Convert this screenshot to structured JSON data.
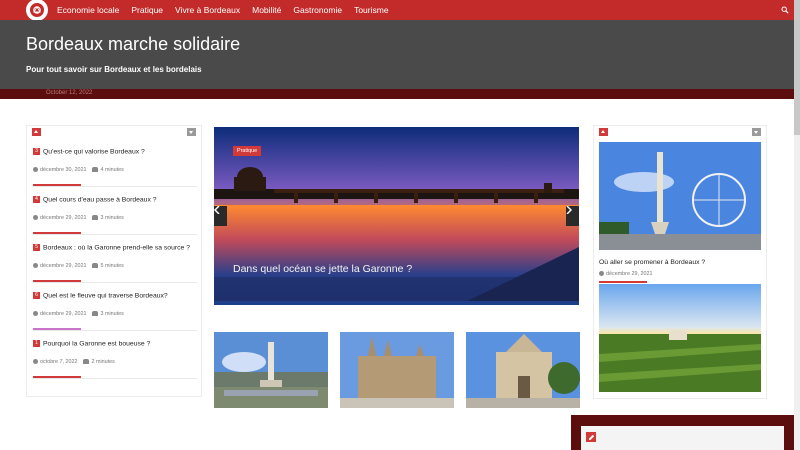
{
  "nav": {
    "items": [
      "Economie locale",
      "Pratique",
      "Vivre à Bordeaux",
      "Mobilité",
      "Gastronomie",
      "Tourisme"
    ]
  },
  "header": {
    "title": "Bordeaux marche solidaire",
    "tagline": "Pour tout savoir sur Bordeaux et les bordelais",
    "date": "October 12, 2022"
  },
  "left_list": {
    "items": [
      {
        "num": "3",
        "title": "Qu'est-ce qui valorise Bordeaux ?",
        "date": "décembre 30, 2021",
        "read": "4 minutes"
      },
      {
        "num": "4",
        "title": "Quel cours d'eau passe à Bordeaux ?",
        "date": "décembre 29, 2021",
        "read": "3 minutes"
      },
      {
        "num": "5",
        "title": "Bordeaux : où la Garonne prend-elle sa source ?",
        "date": "décembre 29, 2021",
        "read": "5 minutes"
      },
      {
        "num": "6",
        "title": "Quel est le fleuve qui traverse Bordeaux?",
        "date": "décembre 29, 2021",
        "read": "3 minutes"
      },
      {
        "num": "1",
        "title": "Pourquoi la Garonne est boueuse ?",
        "date": "octobre 7, 2022",
        "read": "2 minutes"
      }
    ]
  },
  "slider": {
    "tag": "Pratique",
    "caption": "Dans quel océan se jette la Garonne ?"
  },
  "right_col": {
    "card1": {
      "title": "Où aller se promener à Bordeaux ?",
      "date": "décembre 29, 2021"
    }
  },
  "colors": {
    "brand_red": "#c32a2a",
    "header_gray": "#4a4a4a",
    "dark_maroon": "#5c0e0e",
    "accent": "#d23a3a"
  }
}
